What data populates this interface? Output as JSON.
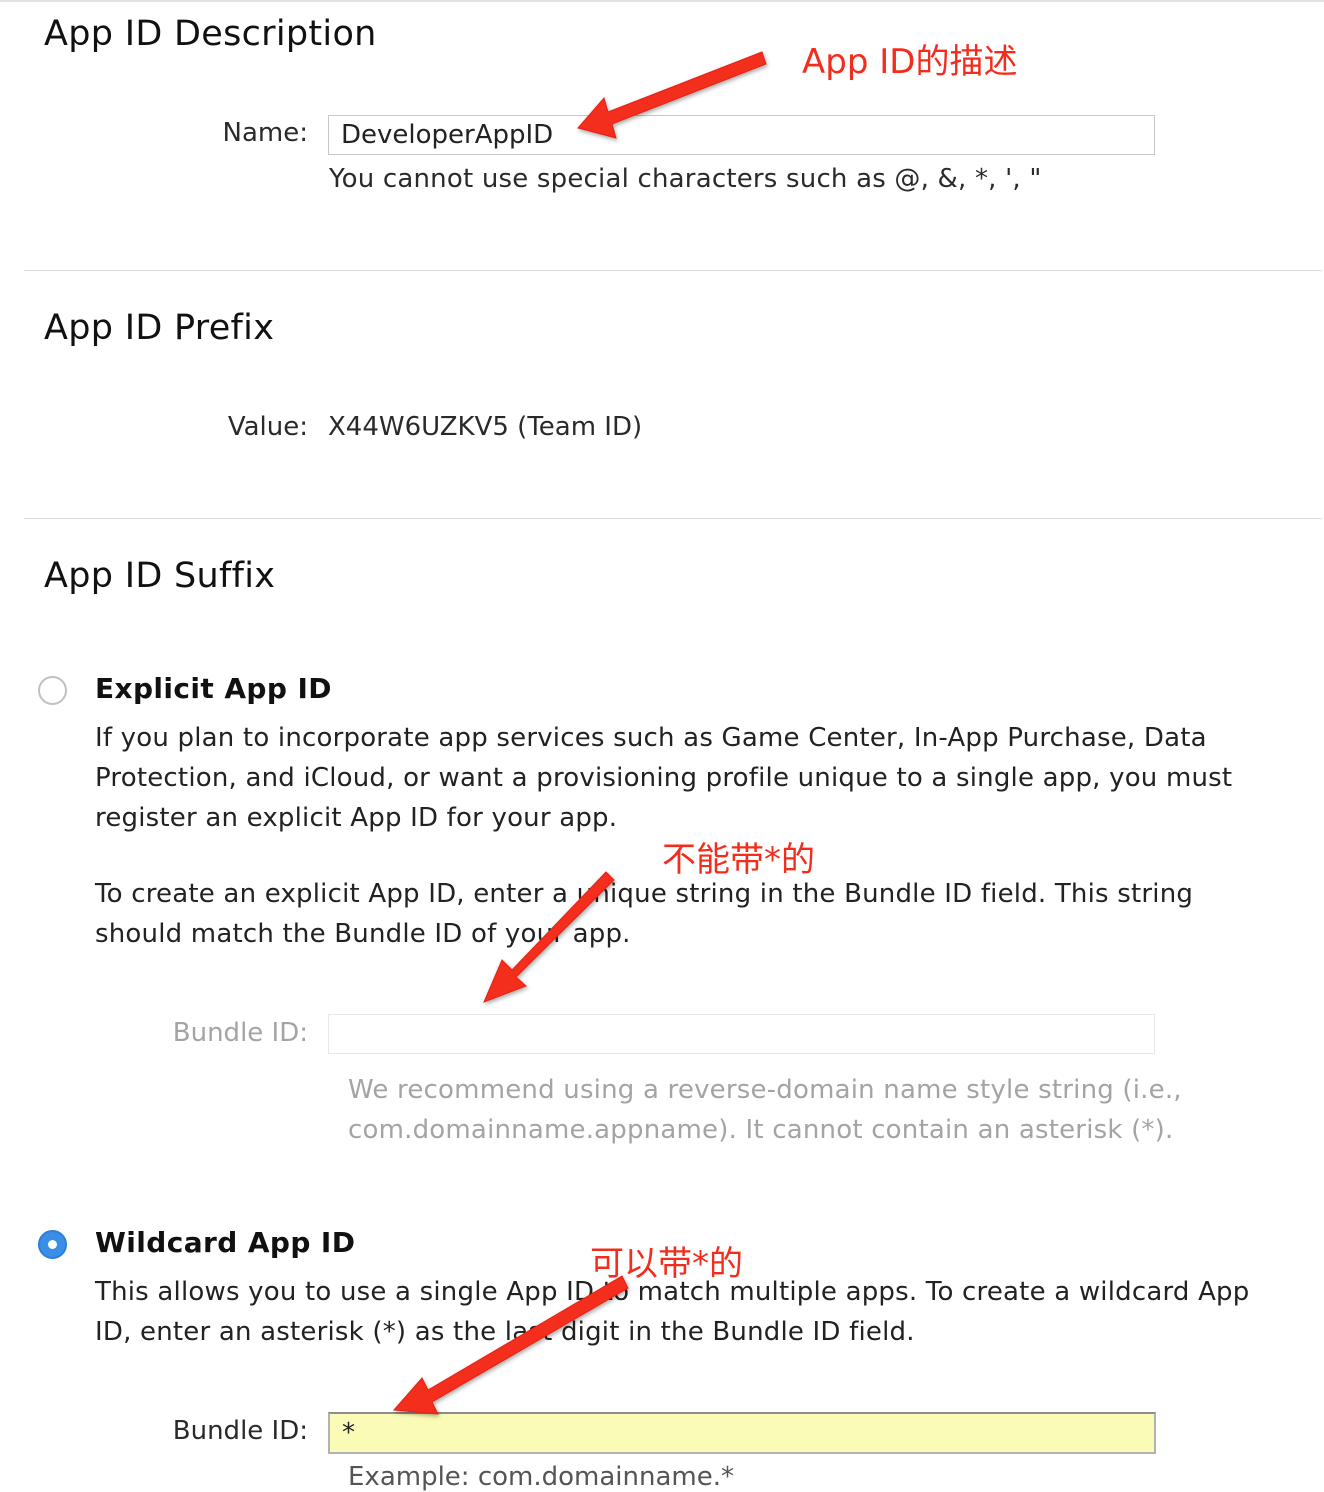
{
  "description_section": {
    "heading": "App ID Description",
    "name_label": "Name:",
    "name_value": "DeveloperAppID",
    "name_hint": "You cannot use special characters such as @, &, *, ', \""
  },
  "prefix_section": {
    "heading": "App ID Prefix",
    "value_label": "Value:",
    "value_text": "X44W6UZKV5 (Team ID)"
  },
  "suffix_section": {
    "heading": "App ID Suffix",
    "explicit": {
      "selected": false,
      "title": "Explicit App ID",
      "paragraph_1": "If you plan to incorporate app services such as Game Center, In-App Purchase, Data Protection, and iCloud, or want a provisioning profile unique to a single app, you must register an explicit App ID for your app.",
      "paragraph_2": "To create an explicit App ID, enter a unique string in the Bundle ID field. This string should match the Bundle ID of your app.",
      "bundle_label": "Bundle ID:",
      "bundle_value": "",
      "bundle_hint": "We recommend using a reverse-domain name style string (i.e., com.domainname.appname). It cannot contain an asterisk (*)."
    },
    "wildcard": {
      "selected": true,
      "title": "Wildcard App ID",
      "paragraph": "This allows you to use a single App ID to match multiple apps. To create a wildcard App ID, enter an asterisk (*) as the last digit in the Bundle ID field.",
      "bundle_label": "Bundle ID:",
      "bundle_value": "*",
      "bundle_hint_fragment": "Example: com.domainname.*"
    }
  },
  "annotations": {
    "description_note": "App ID的描述",
    "explicit_note": "不能带*的",
    "wildcard_note": "可以带*的"
  },
  "colors": {
    "annotation_red": "#f32d1e",
    "radio_selected_blue": "#3a8ee6",
    "highlight_input_yellow": "#fbfbb8",
    "divider_gray": "#dddddd"
  },
  "icons": {
    "radio_unselected": "radio-unselected-icon",
    "radio_selected": "radio-selected-icon",
    "annotation_arrow": "red-arrow-icon"
  }
}
